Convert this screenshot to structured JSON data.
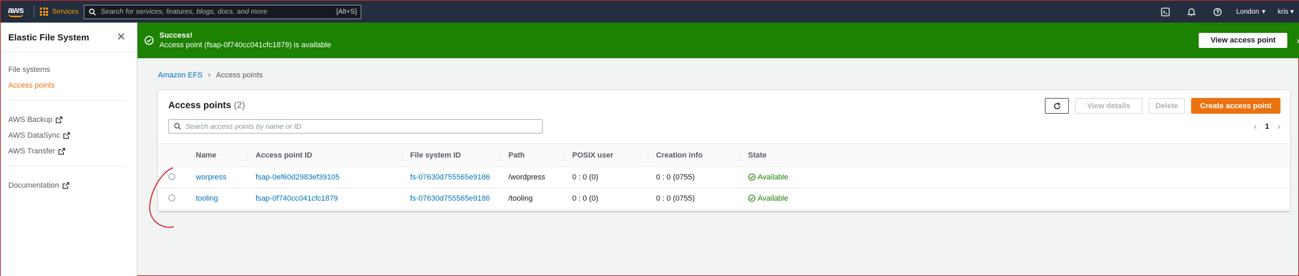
{
  "topnav": {
    "logo": "aws",
    "services_label": "Services",
    "search_placeholder": "Search for services, features, blogs, docs, and more",
    "search_shortcut": "[Alt+S]",
    "region": "London",
    "user": "kris",
    "icons": [
      "cloudshell-icon",
      "bell-icon",
      "help-icon"
    ]
  },
  "sidebar": {
    "title": "Elastic File System",
    "primary": [
      {
        "label": "File systems",
        "active": false
      },
      {
        "label": "Access points",
        "active": true
      }
    ],
    "services": [
      {
        "label": "AWS Backup"
      },
      {
        "label": "AWS DataSync"
      },
      {
        "label": "AWS Transfer"
      }
    ],
    "docs": [
      {
        "label": "Documentation"
      }
    ]
  },
  "flash": {
    "title": "Success!",
    "message": "Access point (fsap-0f740cc041cfc1879) is available",
    "button": "View access point"
  },
  "breadcrumb": {
    "root": "Amazon EFS",
    "current": "Access points"
  },
  "panel": {
    "title": "Access points",
    "count": "(2)",
    "buttons": {
      "view_details": "View details",
      "delete": "Delete",
      "create": "Create access point"
    },
    "search_placeholder": "Search access points by name or ID",
    "page": "1",
    "columns": [
      "Name",
      "Access point ID",
      "File system ID",
      "Path",
      "POSIX user",
      "Creation info",
      "State"
    ],
    "rows": [
      {
        "name": "worpress",
        "ap_id": "fsap-0ef60d2983ef39105",
        "fs_id": "fs-07630d755565e9186",
        "path": "/wordpress",
        "posix": "0 : 0 (0)",
        "creation": "0 : 0 (0755)",
        "state": "Available"
      },
      {
        "name": "tooling",
        "ap_id": "fsap-0f740cc041cfc1879",
        "fs_id": "fs-07630d755565e9186",
        "path": "/tooling",
        "posix": "0 : 0 (0)",
        "creation": "0 : 0 (0755)",
        "state": "Available"
      }
    ]
  },
  "colors": {
    "nav": "#232f3e",
    "accent": "#ec7211",
    "success": "#1d8102",
    "link": "#0073bb"
  }
}
